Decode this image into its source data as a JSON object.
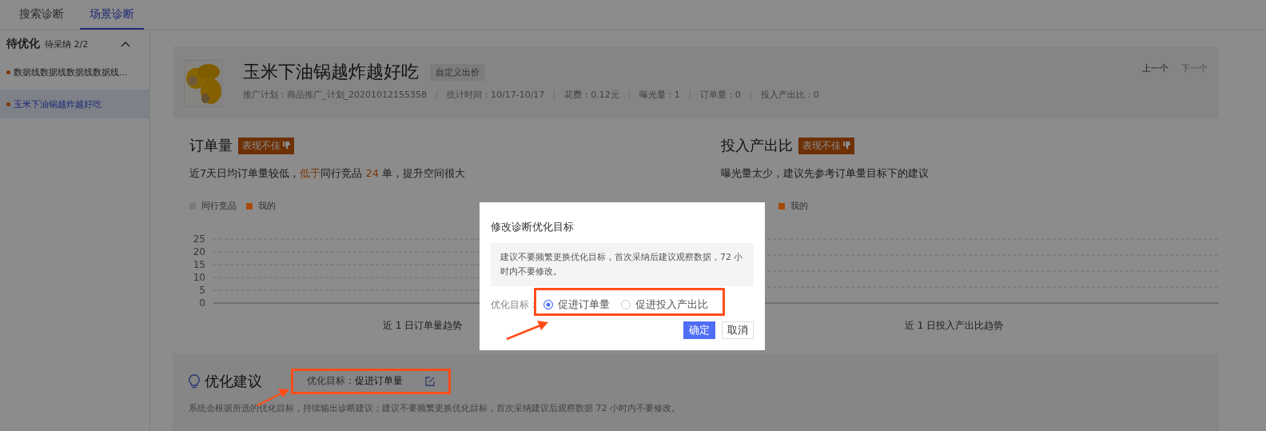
{
  "tabs": [
    {
      "label": "搜索诊断",
      "selected": false
    },
    {
      "label": "场景诊断",
      "selected": true
    }
  ],
  "sidebar": {
    "title": "待优化",
    "count": "待采纳 2/2",
    "expanded": true,
    "items": [
      {
        "label": "数据线数据线数据线数据线...",
        "selected": false
      },
      {
        "label": "玉米下油锅越炸越好吃",
        "selected": true
      }
    ]
  },
  "product": {
    "title": "玉米下油锅越炸越好吃",
    "tag": "自定义出价",
    "meta": [
      "推广计划：商品推广_计划_20201012155358",
      "统计时间：10/17-10/17",
      "花费：0.12元",
      "曝光量：1",
      "订单量：0",
      "投入产出比：0"
    ],
    "prev": "上一个",
    "next": "下一个",
    "next_disabled": true
  },
  "metrics": [
    {
      "title": "订单量",
      "badge": "表现不佳",
      "description": [
        {
          "text": "近7天日均订单量较低，",
          "highlight": false
        },
        {
          "text": "低于",
          "highlight": true
        },
        {
          "text": "同行竞品 ",
          "highlight": false
        },
        {
          "text": "24",
          "highlight": true
        },
        {
          "text": " 单，提升空间很大",
          "highlight": false
        }
      ],
      "legend": [
        {
          "name": "同行竞品",
          "color": "#7a7a7a"
        },
        {
          "name": "我的",
          "color": "#a84a08"
        }
      ],
      "yticks": [
        "25",
        "20",
        "15",
        "10",
        "5",
        "0"
      ],
      "trend_title": "近 1 日订单量趋势"
    },
    {
      "title": "投入产出比",
      "badge": "表现不佳",
      "description": [
        {
          "text": "曝光量太少，建议先参考订单量目标下的建议",
          "highlight": false
        }
      ],
      "legend": [
        {
          "name": "我的",
          "color": "#a84a08"
        }
      ],
      "trend_title": "近 1 日投入产出比趋势"
    }
  ],
  "advice": {
    "title": "优化建议",
    "goal_label": "优化目标：",
    "goal_value": "促进订单量",
    "note": "系统会根据所选的优化目标，持续输出诊断建议；建议不要频繁更换优化目标，首次采纳建议后观察数据 72 小时内不要修改。"
  },
  "dialog": {
    "title": "修改诊断优化目标",
    "notice": "建议不要频繁更换优化目标，首次采纳后建议观察数据，72 小时内不要修改。",
    "field_label": "优化目标：",
    "options": [
      {
        "label": "促进订单量",
        "selected": true
      },
      {
        "label": "促进投入产出比",
        "selected": false
      }
    ],
    "buttons": [
      {
        "label": "确定",
        "kind": "primary"
      },
      {
        "label": "取消",
        "kind": "default"
      }
    ]
  }
}
